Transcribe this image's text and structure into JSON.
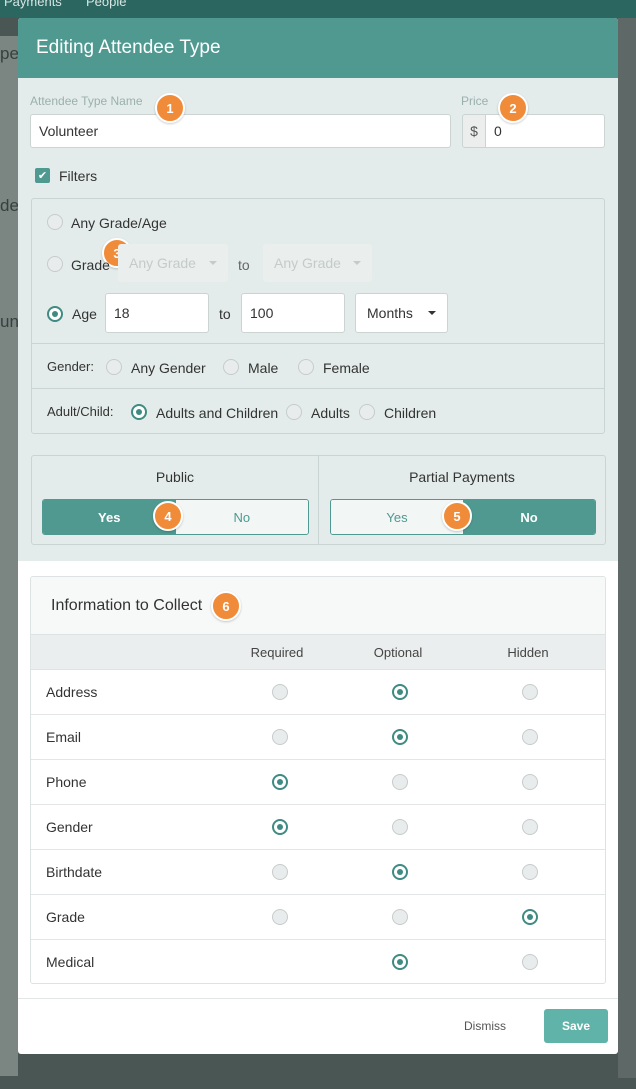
{
  "background": {
    "nav_items": [
      "Payments",
      "People"
    ],
    "left_fragments": [
      "pe",
      "de",
      "un"
    ]
  },
  "modal": {
    "title": "Editing Attendee Type"
  },
  "form": {
    "name_label": "Attendee Type Name",
    "name_value": "Volunteer",
    "price_label": "Price",
    "price_currency": "$",
    "price_value": "0",
    "filters_label": "Filters",
    "filters_checked": true
  },
  "badges": [
    "1",
    "2",
    "3",
    "4",
    "5",
    "6"
  ],
  "filters": {
    "any_grade_age": "Any Grade/Age",
    "grade_label": "Grade",
    "grade_from": "Any Grade",
    "grade_to": "Any Grade",
    "to_label": "to",
    "age_label": "Age",
    "age_min": "18",
    "age_max": "100",
    "age_unit": "Months",
    "selected": "Age",
    "gender_label": "Gender:",
    "gender_options": [
      "Any Gender",
      "Male",
      "Female"
    ],
    "adult_child_label": "Adult/Child:",
    "adult_child_options": [
      "Adults and Children",
      "Adults",
      "Children"
    ],
    "adult_child_selected": "Adults and Children"
  },
  "public": {
    "title": "Public",
    "yes": "Yes",
    "no": "No",
    "selected": "Yes"
  },
  "partial_payments": {
    "title": "Partial Payments",
    "yes": "Yes",
    "no": "No",
    "selected": "No"
  },
  "info": {
    "title": "Information to Collect",
    "columns": [
      "Required",
      "Optional",
      "Hidden"
    ],
    "rows": [
      {
        "label": "Address",
        "selected": "Optional"
      },
      {
        "label": "Email",
        "selected": "Optional"
      },
      {
        "label": "Phone",
        "selected": "Required"
      },
      {
        "label": "Gender",
        "selected": "Required"
      },
      {
        "label": "Birthdate",
        "selected": "Optional"
      },
      {
        "label": "Grade",
        "selected": "Hidden"
      },
      {
        "label": "Medical",
        "selected": "Optional"
      }
    ]
  },
  "footer": {
    "dismiss": "Dismiss",
    "save": "Save"
  },
  "colors": {
    "teal": "#4f9991",
    "badge_orange": "#f08b39",
    "save_button": "#5fb3a8"
  }
}
